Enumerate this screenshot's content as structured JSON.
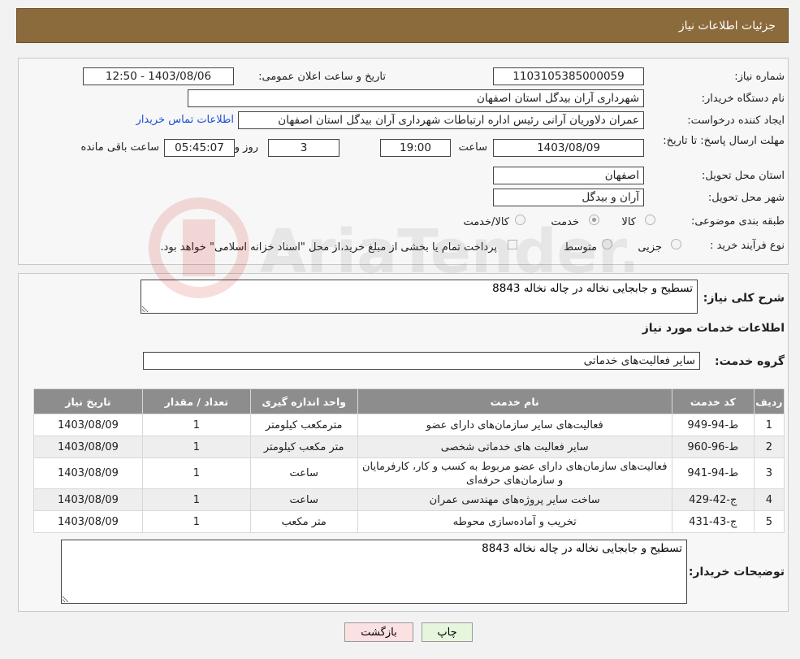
{
  "header": {
    "title": "جزئیات اطلاعات نیاز"
  },
  "form": {
    "need_number_label": "شماره نیاز:",
    "need_number": "1103105385000059",
    "announce_label": "تاریخ و ساعت اعلان عمومی:",
    "announce_value": "1403/08/06 - 12:50",
    "buyer_label": "نام دستگاه خریدار:",
    "buyer_value": "شهرداری آران بیدگل استان اصفهان",
    "creator_label": "ایجاد کننده درخواست:",
    "creator_value": "عمران دلاوریان آرانی رئیس اداره ارتباطات شهرداری آران بیدگل استان اصفهان",
    "contact_link": "اطلاعات تماس خریدار",
    "deadline_label": "مهلت ارسال پاسخ: تا تاریخ:",
    "deadline_date": "1403/08/09",
    "time_label": "ساعت",
    "deadline_time": "19:00",
    "days_value": "3",
    "days_label": "روز و",
    "remaining_value": "05:45:07",
    "remaining_label": "ساعت باقی مانده",
    "province_label": "استان محل تحویل:",
    "province_value": "اصفهان",
    "city_label": "شهر محل تحویل:",
    "city_value": "آران و بیدگل",
    "category_label": "طبقه بندی موضوعی:",
    "category_options": [
      "کالا",
      "خدمت",
      "کالا/خدمت"
    ],
    "category_selected": "خدمت",
    "process_label": "نوع فرآیند خرید :",
    "process_options": [
      "جزیی",
      "متوسط"
    ],
    "payment_note": "پرداخت تمام یا بخشی از مبلغ خرید،از محل \"اسناد خزانه اسلامی\" خواهد بود."
  },
  "summary": {
    "label": "شرح کلی نیاز:",
    "value": "تسطیح و جابجایی نخاله در چاله نخاله 8843"
  },
  "services": {
    "section_title": "اطلاعات خدمات مورد نیاز",
    "group_label": "گروه خدمت:",
    "group_value": "سایر فعالیت‌های خدماتی",
    "columns": [
      "ردیف",
      "کد خدمت",
      "نام خدمت",
      "واحد اندازه گیری",
      "تعداد / مقدار",
      "تاریخ نیاز"
    ],
    "rows": [
      [
        "1",
        "ط-94-949",
        "فعالیت‌های سایر سازمان‌های دارای عضو",
        "مترمکعب کیلومتر",
        "1",
        "1403/08/09"
      ],
      [
        "2",
        "ط-96-960",
        "سایر فعالیت های خدماتی شخصی",
        "متر مکعب کیلومتر",
        "1",
        "1403/08/09"
      ],
      [
        "3",
        "ط-94-941",
        "فعالیت‌های سازمان‌های دارای عضو مربوط به کسب و کار، کارفرمایان و سازمان‌های حرفه‌ای",
        "ساعت",
        "1",
        "1403/08/09"
      ],
      [
        "4",
        "ج-42-429",
        "ساخت سایر پروژه‌های مهندسی عمران",
        "ساعت",
        "1",
        "1403/08/09"
      ],
      [
        "5",
        "ج-43-431",
        "تخریب و آماده‌سازی محوطه",
        "متر مکعب",
        "1",
        "1403/08/09"
      ]
    ]
  },
  "buyer_notes": {
    "label": "توضیحات خریدار:",
    "value": "تسطیح و جابجایی نخاله در چاله نخاله 8843"
  },
  "buttons": {
    "print": "چاپ",
    "back": "بازگشت"
  },
  "watermark": {
    "text": "AriaTender.neT"
  }
}
